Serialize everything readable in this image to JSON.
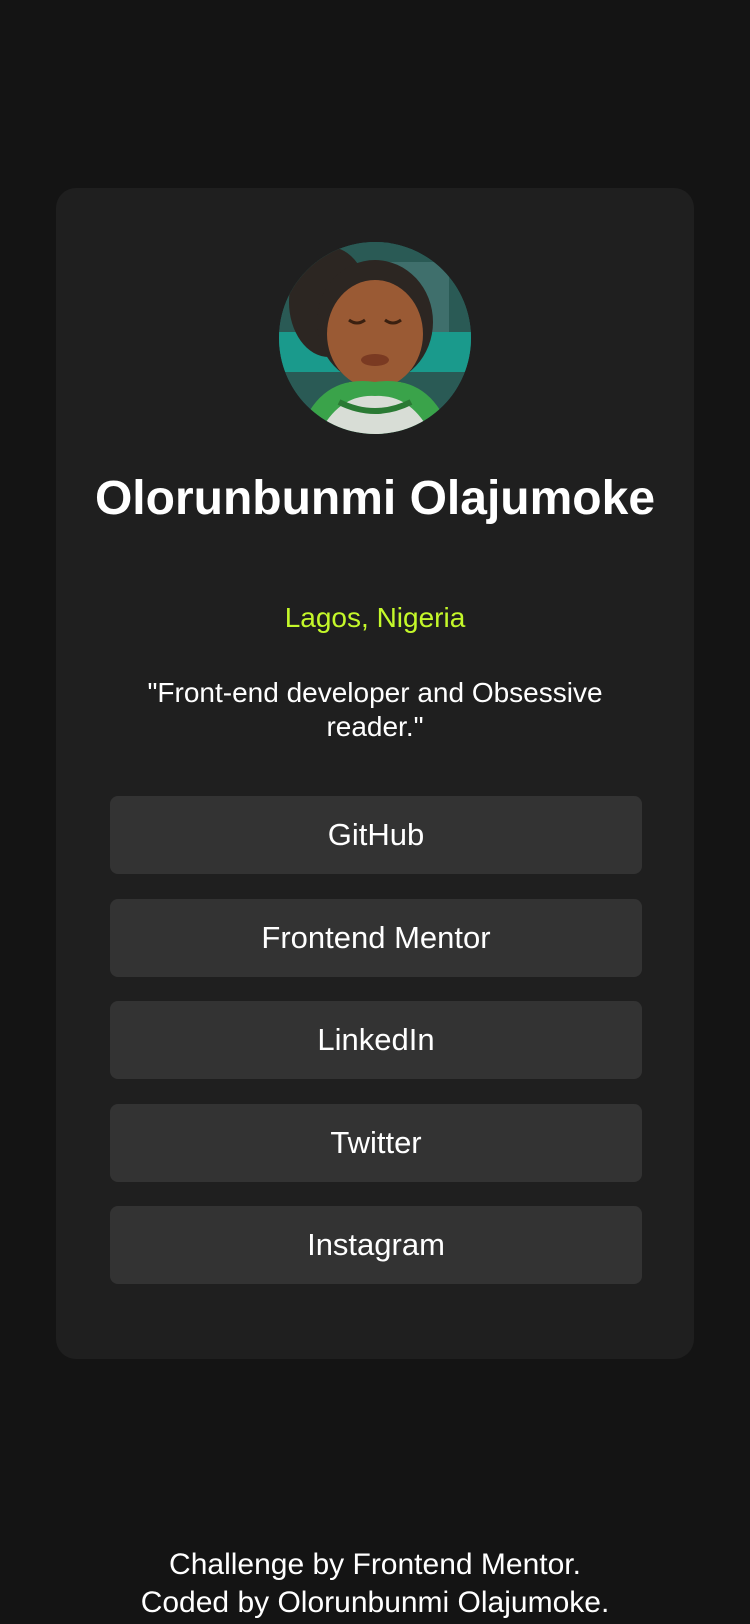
{
  "profile": {
    "avatar_alt": "Profile picture of Olorunbunmi Olajumoke",
    "name": "Olorunbunmi Olajumoke",
    "location": "Lagos, Nigeria",
    "bio": "\"Front-end developer and Obsessive reader.\""
  },
  "links": [
    {
      "label": "GitHub"
    },
    {
      "label": "Frontend Mentor"
    },
    {
      "label": "LinkedIn"
    },
    {
      "label": "Twitter"
    },
    {
      "label": "Instagram"
    }
  ],
  "footer": {
    "line1": "Challenge by Frontend Mentor.",
    "line2": "Coded by Olorunbunmi Olajumoke."
  },
  "colors": {
    "page_background": "#141414",
    "card_background": "#1f1f1f",
    "button_background": "#333333",
    "accent": "#c4f82a",
    "text": "#ffffff"
  }
}
